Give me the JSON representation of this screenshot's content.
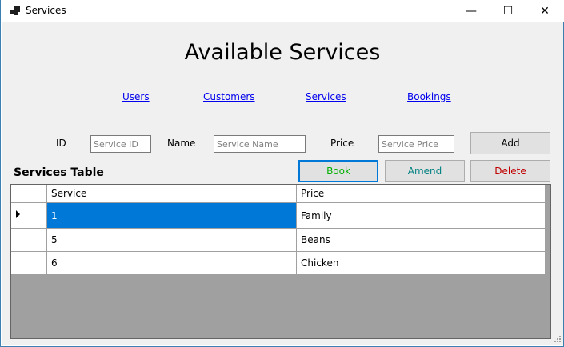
{
  "window": {
    "title": "Services",
    "minimize_glyph": "—",
    "maximize_glyph": "☐",
    "close_glyph": "✕"
  },
  "heading": "Available Services",
  "nav": [
    {
      "label": "Users"
    },
    {
      "label": "Customers"
    },
    {
      "label": "Services"
    },
    {
      "label": "Bookings"
    }
  ],
  "form": {
    "id_label": "ID",
    "id_placeholder": "Service ID",
    "name_label": "Name",
    "name_placeholder": "Service Name",
    "price_label": "Price",
    "price_placeholder": "Service Price",
    "add_label": "Add"
  },
  "actions": {
    "book_label": "Book",
    "amend_label": "Amend",
    "delete_label": "Delete",
    "book_color": "#00b000",
    "amend_color": "#008080",
    "delete_color": "#c00000"
  },
  "table": {
    "title": "Services Table",
    "columns": [
      "Service",
      "Price"
    ],
    "rows": [
      {
        "service": "1",
        "price": "Family",
        "selected": true
      },
      {
        "service": "5",
        "price": "Beans",
        "selected": false
      },
      {
        "service": "6",
        "price": "Chicken",
        "selected": false
      }
    ]
  },
  "colors": {
    "selection": "#0078d7",
    "grid_background": "#a0a0a0",
    "client_background": "#f0f0f0"
  }
}
